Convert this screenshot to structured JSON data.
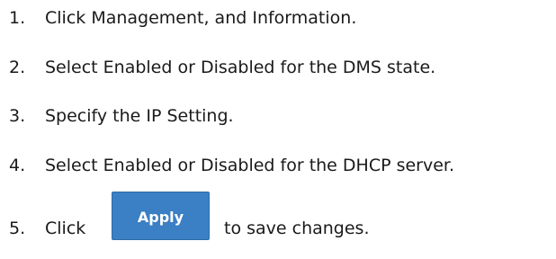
{
  "steps": [
    {
      "number": "1.",
      "text": "Click Management, and Information."
    },
    {
      "number": "2.",
      "text": "Select Enabled or Disabled for the DMS state."
    },
    {
      "number": "3.",
      "text": "Specify the IP Setting."
    },
    {
      "number": "4.",
      "text": "Select Enabled or Disabled for the DHCP server."
    },
    {
      "number": "5.",
      "text_before": "Click",
      "button_label": "Apply",
      "text_after": "to save changes."
    }
  ],
  "colors": {
    "apply_button_bg": "#3b7fc4",
    "apply_button_text": "#ffffff",
    "body_text": "#1a1a1a"
  }
}
